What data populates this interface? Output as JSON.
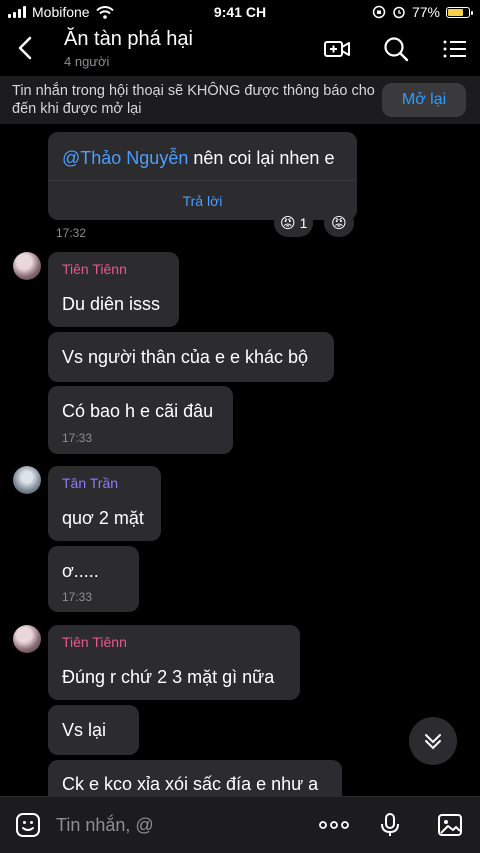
{
  "status_bar": {
    "carrier": "Mobifone",
    "time": "9:41 CH",
    "battery": "77%",
    "battery_level": 0.77
  },
  "header": {
    "title": "Ăn tàn phá hại",
    "subtitle": "4 người"
  },
  "banner": {
    "text": "Tin nhắn trong hội thoại sẽ KHÔNG được thông báo cho đến khi được mở lại",
    "button": "Mở lại"
  },
  "messages": {
    "m1": {
      "mention": "@Thảo Nguyễn",
      "text": " nên coi lại nhen e",
      "action": "Trả lời",
      "reaction_count": "1",
      "time": "17:32"
    },
    "g1": {
      "sender": "Tiên Tiênn",
      "sender_color": "#e8588b",
      "b1": "Du diên isss",
      "b2": "Vs người thân của e e khác bộ",
      "b3": "Có bao h e cãi đâu",
      "b3_time": "17:33"
    },
    "g2": {
      "sender": "Tân Trần",
      "sender_color": "#8b7cf6",
      "b1": "quơ 2 mặt",
      "b2": "ơ.....",
      "b2_time": "17:33"
    },
    "g3": {
      "sender": "Tiên Tiênn",
      "sender_color": "#e8588b",
      "b1": "Đúng r chứ 2 3 mặt gì nữa",
      "b2": "Vs lại",
      "b3": "Ck e kco xỉa xói sấc đía e như a"
    }
  },
  "composer": {
    "placeholder": "Tin nhắn, @"
  },
  "colors": {
    "accent": "#2e9bff",
    "bubble": "#2c2c2e"
  }
}
